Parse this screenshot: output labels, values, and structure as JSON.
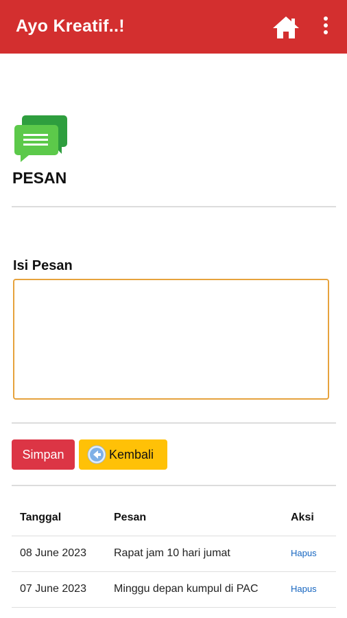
{
  "app_bar": {
    "title": "Ayo Kreatif..!",
    "home_icon": "home-icon",
    "menu_icon": "more-vert-icon",
    "bg_color": "#d32f2f"
  },
  "header": {
    "icon": "chat-bubbles-icon",
    "title": "PESAN"
  },
  "form": {
    "label": "Isi Pesan",
    "message_value": "",
    "border_color": "#e6a23c"
  },
  "buttons": {
    "save_label": "Simpan",
    "back_label": "Kembali",
    "back_icon": "arrow-left-circle-icon",
    "save_color": "#dc3545",
    "back_color": "#ffc107"
  },
  "table": {
    "headers": [
      "Tanggal",
      "Pesan",
      "Aksi"
    ],
    "rows": [
      {
        "tanggal": "08 June 2023",
        "pesan": "Rapat jam 10 hari jumat",
        "aksi": "Hapus"
      },
      {
        "tanggal": "07 June 2023",
        "pesan": "Minggu depan kumpul di PAC",
        "aksi": "Hapus"
      }
    ]
  }
}
